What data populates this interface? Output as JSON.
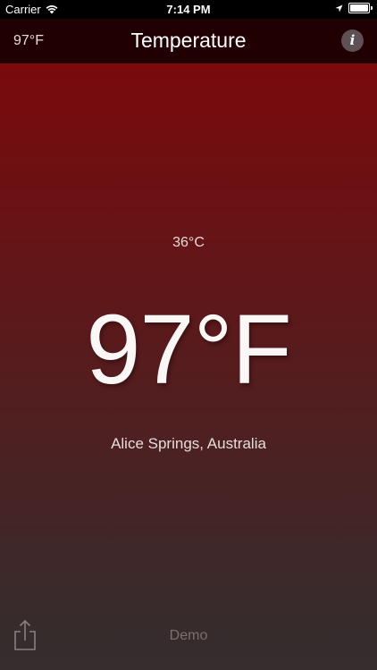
{
  "status_bar": {
    "carrier": "Carrier",
    "time": "7:14 PM"
  },
  "nav": {
    "left_value": "97°F",
    "title": "Temperature",
    "info_glyph": "i"
  },
  "main": {
    "celsius": "36°C",
    "fahrenheit": "97°F",
    "location": "Alice Springs, Australia"
  },
  "footer": {
    "demo_label": "Demo"
  },
  "icons": {
    "wifi": "wifi-icon",
    "location": "location-arrow-icon",
    "battery": "battery-icon",
    "info": "info-icon",
    "share": "share-icon"
  },
  "colors": {
    "background_top": "#7a0508",
    "background_bottom": "#352d2e",
    "nav_background": "#200001",
    "info_button": "#5e5054"
  }
}
